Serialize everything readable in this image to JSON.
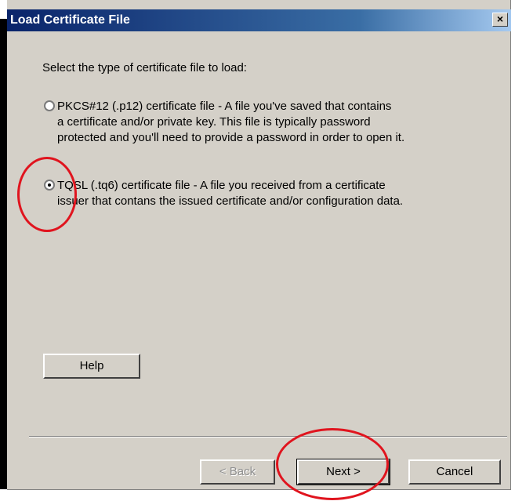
{
  "window": {
    "title": "Load Certificate File",
    "close_glyph": "×"
  },
  "prompt": "Select the type of certificate file to load:",
  "options": [
    {
      "lines": [
        "PKCS#12 (.p12) certificate file - A file you've saved that contains",
        "a certificate and/or private key. This file is typically password",
        "protected and you'll need to provide a password in order to open it."
      ],
      "selected": false
    },
    {
      "lines": [
        "TQSL (.tq6) certificate file - A file you received from a certificate",
        "issuer that contans the issued certificate and/or configuration data."
      ],
      "selected": true
    }
  ],
  "buttons": {
    "help": "Help",
    "back": "< Back",
    "next": "Next >",
    "cancel": "Cancel"
  },
  "colors": {
    "dialog_bg": "#d4d0c8",
    "titlebar": "#0a246a",
    "annotation": "#e0141e"
  }
}
